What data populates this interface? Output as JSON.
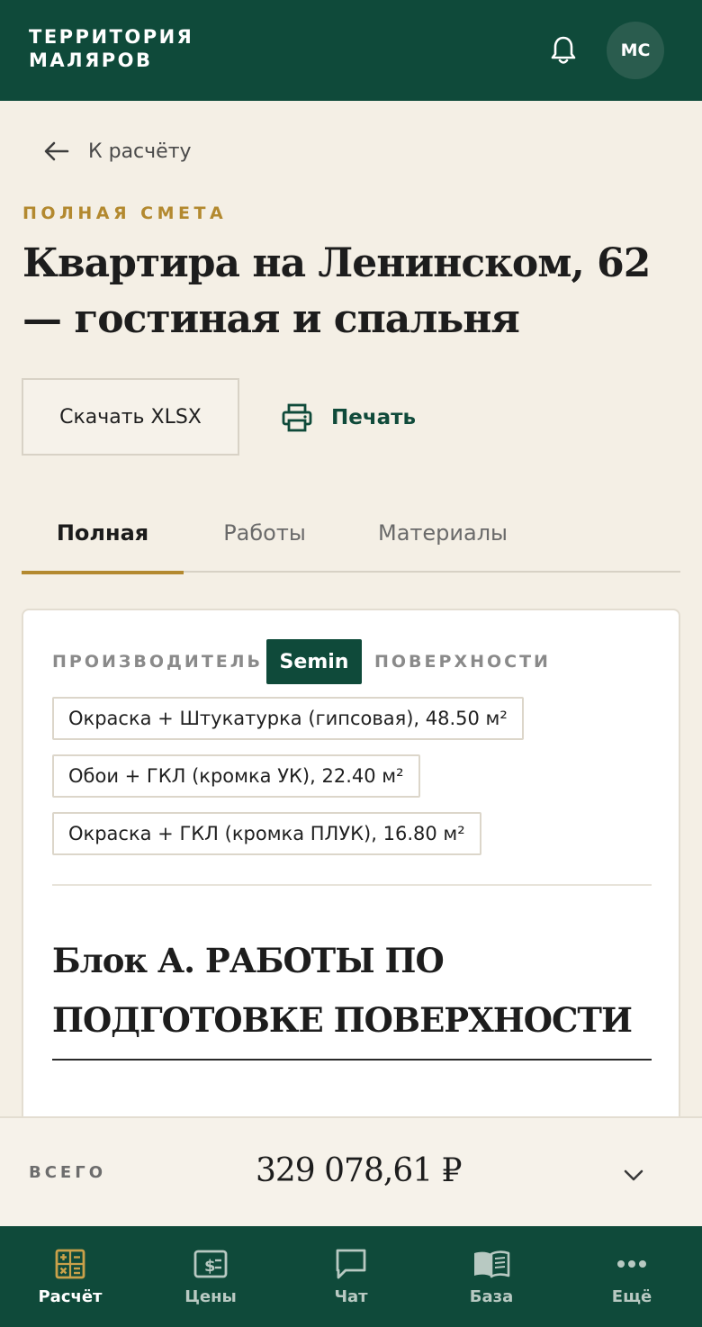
{
  "header": {
    "brand_line1": "ТЕРРИТОРИЯ",
    "brand_line2": "МАЛЯРОВ",
    "avatar_initials": "МС"
  },
  "back_link": {
    "label": "К расчёту"
  },
  "page": {
    "eyebrow": "ПОЛНАЯ СМЕТА",
    "title": "Квартира на Ленинском, 62 — гостиная и спальня"
  },
  "actions": {
    "download_label": "Скачать XLSX",
    "print_label": "Печать"
  },
  "tabs": [
    {
      "label": "Полная",
      "active": true
    },
    {
      "label": "Работы",
      "active": false
    },
    {
      "label": "Материалы",
      "active": false
    }
  ],
  "card": {
    "manufacturer_label": "ПРОИЗВОДИТЕЛЬ",
    "manufacturer_value": "Semin",
    "surfaces_label": "ПОВЕРХНОСТИ",
    "surfaces": [
      "Окраска + Штукатурка (гипсовая), 48.50 м²",
      "Обои + ГКЛ (кромка УК), 22.40 м²",
      "Окраска + ГКЛ (кромка ПЛУК), 16.80 м²"
    ],
    "block_title": "Блок А. РАБОТЫ ПО ПОДГОТОВКЕ ПОВЕРХНОСТИ"
  },
  "total": {
    "label": "ВСЕГО",
    "value": "329 078,61 ₽"
  },
  "bottom_nav": [
    {
      "label": "Расчёт",
      "icon": "calculator-icon",
      "active": true
    },
    {
      "label": "Цены",
      "icon": "price-tag-icon",
      "active": false
    },
    {
      "label": "Чат",
      "icon": "chat-icon",
      "active": false
    },
    {
      "label": "База",
      "icon": "book-icon",
      "active": false
    },
    {
      "label": "Ещё",
      "icon": "more-dots-icon",
      "active": false
    }
  ],
  "colors": {
    "brand_green": "#0f4a3a",
    "accent_gold": "#b3892f",
    "background": "#f4efe5"
  }
}
